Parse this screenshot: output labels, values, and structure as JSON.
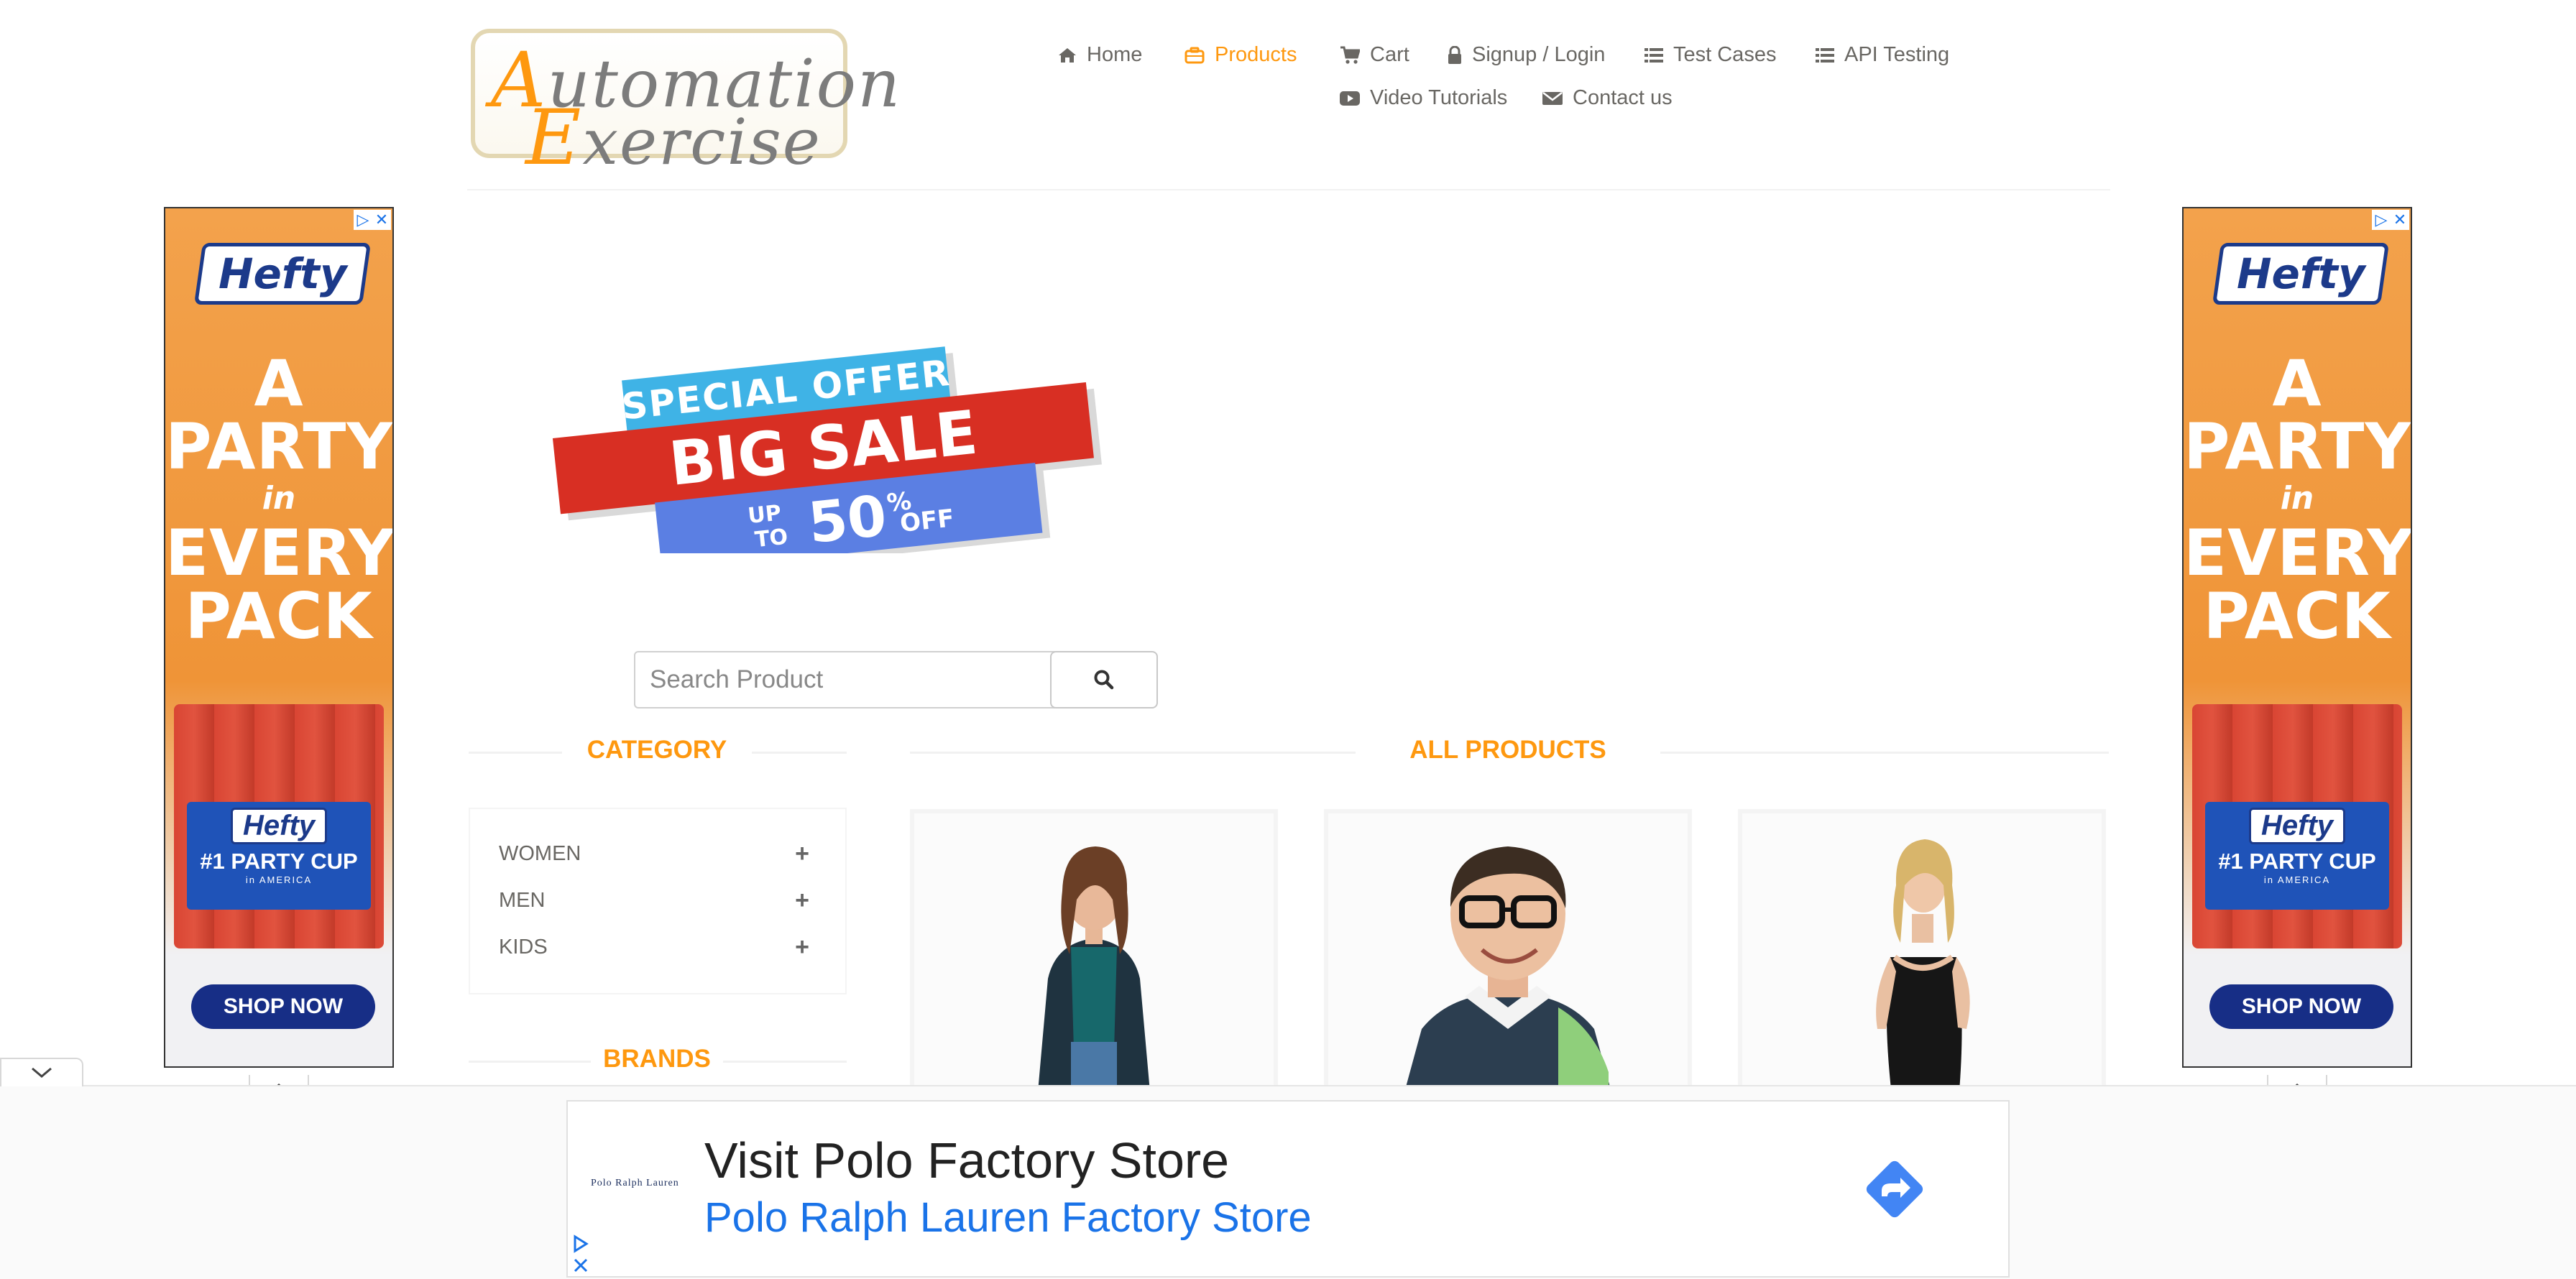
{
  "header": {
    "logo": {
      "line1_cap": "A",
      "line1_rest": "utomation",
      "line2_cap": "E",
      "line2_rest": "xercise"
    },
    "nav": [
      {
        "label": "Home",
        "icon": "home-icon"
      },
      {
        "label": "Products",
        "icon": "products-icon",
        "active": true
      },
      {
        "label": "Cart",
        "icon": "cart-icon"
      },
      {
        "label": "Signup / Login",
        "icon": "lock-icon"
      },
      {
        "label": "Test Cases",
        "icon": "list-icon"
      },
      {
        "label": "API Testing",
        "icon": "list-icon"
      },
      {
        "label": "Video Tutorials",
        "icon": "youtube-icon"
      },
      {
        "label": "Contact us",
        "icon": "envelope-icon"
      }
    ],
    "accent_color": "#fe980f"
  },
  "side_ad": {
    "brand": "Hefty",
    "headline_1": "A",
    "headline_2": "PARTY",
    "headline_3": "in",
    "headline_4": "EVERY",
    "headline_5": "PACK",
    "cup_brand": "Hefty",
    "cup_text": "#1 PARTY CUP",
    "cup_sub": "in AMERICA",
    "cta": "SHOP NOW"
  },
  "banner": {
    "top": "SPECIAL OFFER",
    "middle": "BIG SALE",
    "up_to_1": "UP",
    "up_to_2": "TO",
    "percent": "50",
    "percent_sign": "%",
    "off": "OFF"
  },
  "search": {
    "placeholder": "Search Product",
    "icon": "search-icon"
  },
  "sidebar": {
    "category_title": "CATEGORY",
    "categories": [
      {
        "label": "WOMEN"
      },
      {
        "label": "MEN"
      },
      {
        "label": "KIDS"
      }
    ],
    "brands_title": "BRANDS"
  },
  "products": {
    "title": "ALL PRODUCTS"
  },
  "bottom_ad": {
    "brand_mini": "Polo Ralph Lauren",
    "headline": "Visit Polo Factory Store",
    "sub": "Polo Ralph Lauren Factory Store"
  }
}
